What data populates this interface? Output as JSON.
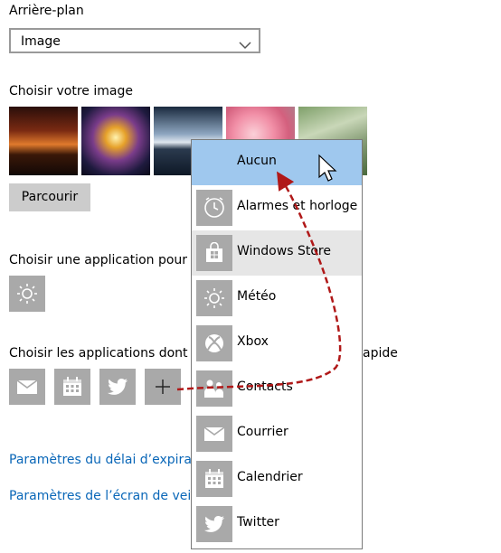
{
  "background": {
    "label": "Arrière-plan",
    "select_value": "Image"
  },
  "image_picker": {
    "label": "Choisir votre image",
    "browse_label": "Parcourir"
  },
  "detailed_status": {
    "label": "Choisir une application pour p"
  },
  "quick_status": {
    "label_left": "Choisir les applications dont vo",
    "label_right": "apide",
    "apps": [
      "mail-icon",
      "calendar-icon",
      "twitter-icon",
      "plus-icon"
    ]
  },
  "links": {
    "timeout": "Paramètres du délai d’expiratio",
    "screensaver": "Paramètres de l’écran de veille"
  },
  "menu": {
    "items": [
      {
        "label": "Aucun",
        "icon": null,
        "state": "selected"
      },
      {
        "label": "Alarmes et horloge",
        "icon": "clock-icon"
      },
      {
        "label": "Windows Store",
        "icon": "store-icon",
        "state": "hover"
      },
      {
        "label": "Météo",
        "icon": "sun-icon"
      },
      {
        "label": "Xbox",
        "icon": "xbox-icon"
      },
      {
        "label": "Contacts",
        "icon": "people-icon"
      },
      {
        "label": "Courrier",
        "icon": "mail-icon"
      },
      {
        "label": "Calendrier",
        "icon": "calendar-icon"
      },
      {
        "label": "Twitter",
        "icon": "twitter-icon"
      }
    ]
  },
  "colors": {
    "selected": "#9fc8ee",
    "hover": "#e6e6e6",
    "tile": "#a9a9a9",
    "link": "#0a67b8",
    "annotation_arrow": "#b01818"
  }
}
